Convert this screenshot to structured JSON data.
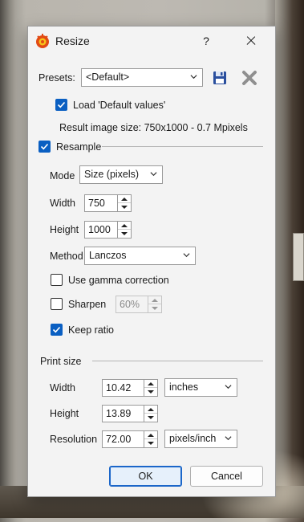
{
  "window": {
    "title": "Resize",
    "help": "?"
  },
  "presets": {
    "label": "Presets:",
    "value": "<Default>"
  },
  "load_defaults": {
    "label": "Load 'Default values'",
    "checked": true
  },
  "result_info": "Result image size: 750x1000 - 0.7 Mpixels",
  "resample": {
    "label": "Resample",
    "checked": true,
    "mode": {
      "label": "Mode",
      "value": "Size (pixels)"
    },
    "width": {
      "label": "Width",
      "value": "750"
    },
    "height": {
      "label": "Height",
      "value": "1000"
    },
    "method": {
      "label": "Method",
      "value": "Lanczos"
    },
    "gamma": {
      "label": "Use gamma correction",
      "checked": false
    },
    "sharpen": {
      "label": "Sharpen",
      "checked": false,
      "value": "60%"
    },
    "keep_ratio": {
      "label": "Keep ratio",
      "checked": true
    }
  },
  "print_size": {
    "label": "Print size",
    "width": {
      "label": "Width",
      "value": "10.42",
      "unit": "inches"
    },
    "height": {
      "label": "Height",
      "value": "13.89"
    },
    "resolution": {
      "label": "Resolution",
      "value": "72.00",
      "unit": "pixels/inch"
    }
  },
  "buttons": {
    "ok": "OK",
    "cancel": "Cancel"
  },
  "colors": {
    "accent": "#0a5fc2",
    "save_icon": "#2a4f9e",
    "delete_icon": "#8f8f8f"
  }
}
